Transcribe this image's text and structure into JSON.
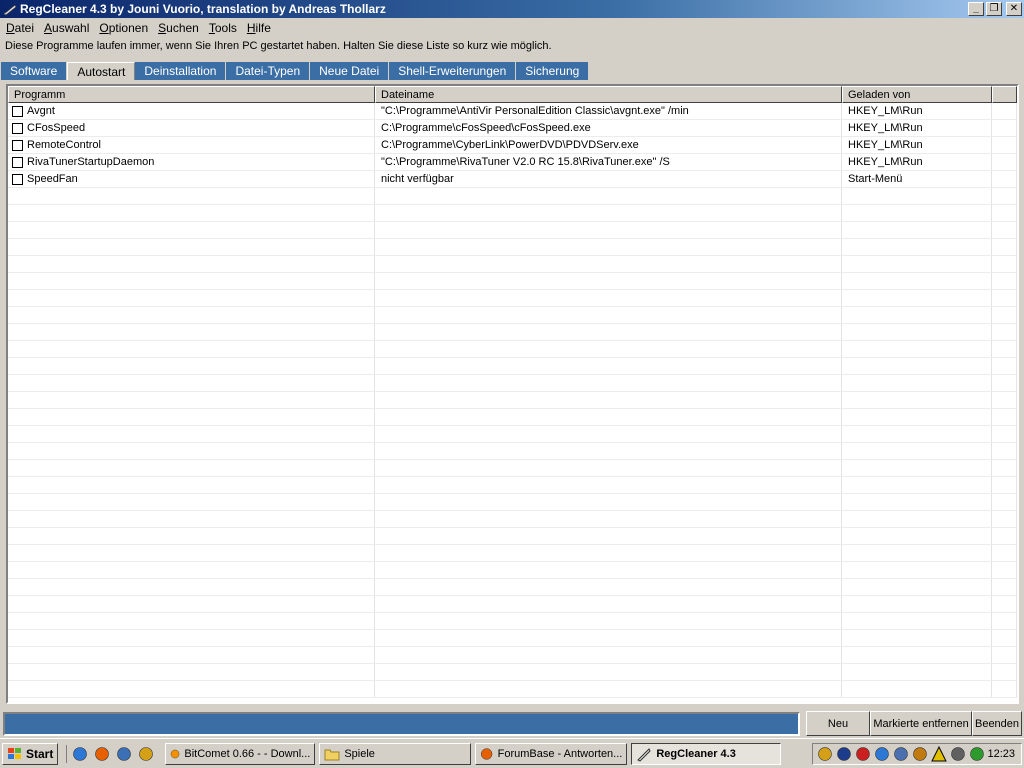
{
  "window": {
    "title": "RegCleaner 4.3 by Jouni Vuorio, translation by Andreas Thollarz"
  },
  "menu": [
    {
      "pre": "",
      "key": "D",
      "post": "atei"
    },
    {
      "pre": "",
      "key": "A",
      "post": "uswahl"
    },
    {
      "pre": "",
      "key": "O",
      "post": "ptionen"
    },
    {
      "pre": "",
      "key": "S",
      "post": "uchen"
    },
    {
      "pre": "",
      "key": "T",
      "post": "ools"
    },
    {
      "pre": "",
      "key": "H",
      "post": "ilfe"
    }
  ],
  "info_text": "Diese Programme laufen immer, wenn Sie Ihren PC gestartet haben. Halten Sie diese Liste so kurz wie möglich.",
  "tabs": [
    {
      "label": "Software",
      "active": false
    },
    {
      "label": "Autostart",
      "active": true
    },
    {
      "label": "Deinstallation",
      "active": false
    },
    {
      "label": "Datei-Typen",
      "active": false
    },
    {
      "label": "Neue Datei",
      "active": false
    },
    {
      "label": "Shell-Erweiterungen",
      "active": false
    },
    {
      "label": "Sicherung",
      "active": false
    }
  ],
  "table": {
    "columns": [
      "Programm",
      "Dateiname",
      "Geladen von",
      ""
    ],
    "rows": [
      {
        "checked": false,
        "program": "Avgnt",
        "file": "\"C:\\Programme\\AntiVir PersonalEdition Classic\\avgnt.exe\" /min",
        "loaded_from": "HKEY_LM\\Run"
      },
      {
        "checked": false,
        "program": "CFosSpeed",
        "file": "C:\\Programme\\cFosSpeed\\cFosSpeed.exe",
        "loaded_from": "HKEY_LM\\Run"
      },
      {
        "checked": false,
        "program": "RemoteControl",
        "file": "C:\\Programme\\CyberLink\\PowerDVD\\PDVDServ.exe",
        "loaded_from": "HKEY_LM\\Run"
      },
      {
        "checked": false,
        "program": "RivaTunerStartupDaemon",
        "file": "\"C:\\Programme\\RivaTuner V2.0 RC 15.8\\RivaTuner.exe\" /S",
        "loaded_from": "HKEY_LM\\Run"
      },
      {
        "checked": false,
        "program": "SpeedFan",
        "file": "nicht verfügbar",
        "loaded_from": "Start-Menü"
      }
    ]
  },
  "buttons": {
    "new": "Neu",
    "remove_marked": "Markierte entfernen",
    "quit": "Beenden"
  },
  "taskbar": {
    "start": "Start",
    "quick_launch": [
      "ie-icon",
      "firefox-icon",
      "thunderbird-icon",
      "winamp-icon"
    ],
    "tasks": [
      {
        "label": "BitComet 0.66 - - Downl...",
        "icon": "bitcomet-icon",
        "active": false,
        "w": 150
      },
      {
        "label": "Spiele",
        "icon": "folder-icon",
        "active": false,
        "w": 152
      },
      {
        "label": "ForumBase - Antworten...",
        "icon": "firefox-icon",
        "active": false,
        "w": 152
      },
      {
        "label": "RegCleaner 4.3",
        "icon": "regcleaner-icon",
        "active": true,
        "w": 150
      }
    ],
    "tray_icons": [
      "security-icon",
      "network-icon",
      "antivir-icon",
      "calendar-icon",
      "display-icon",
      "settings-icon",
      "warning-icon",
      "volume-icon",
      "speedfan-icon"
    ],
    "clock": "12:23"
  },
  "colors": {
    "title_start": "#0a246a",
    "tab_inactive": "#3a6ea5",
    "status_bar": "#3a6ea5",
    "face": "#d4d0c8"
  }
}
